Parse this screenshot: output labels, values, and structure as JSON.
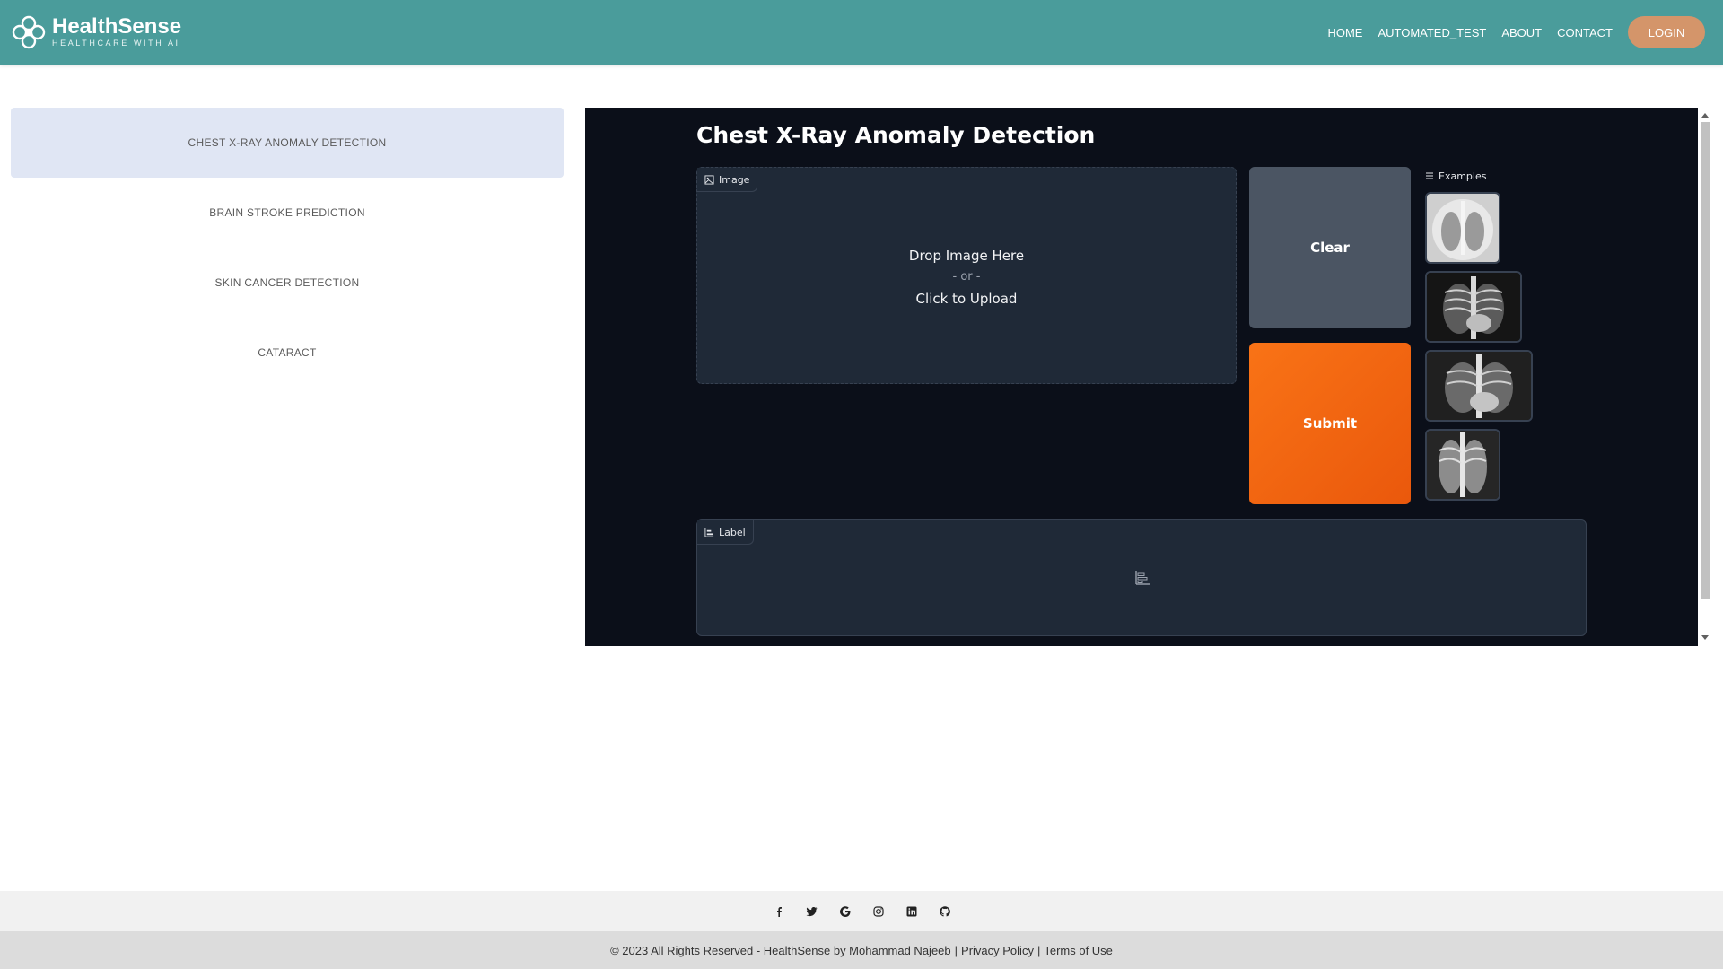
{
  "brand": {
    "name": "HealthSense",
    "tagline": "HEALTHCARE WITH AI"
  },
  "nav": {
    "items": [
      {
        "label": "HOME"
      },
      {
        "label": "AUTOMATED_TEST"
      },
      {
        "label": "ABOUT"
      },
      {
        "label": "CONTACT"
      }
    ],
    "login_label": "LOGIN"
  },
  "sidebar": {
    "items": [
      {
        "label": "CHEST X-RAY ANOMALY DETECTION",
        "active": true
      },
      {
        "label": "BRAIN STROKE PREDICTION",
        "active": false
      },
      {
        "label": "SKIN CANCER DETECTION",
        "active": false
      },
      {
        "label": "CATARACT",
        "active": false
      }
    ]
  },
  "app": {
    "title": "Chest X-Ray Anomaly Detection",
    "image_block": {
      "label": "Image",
      "drop_text": "Drop Image Here",
      "or_text": "- or -",
      "click_text": "Click to Upload"
    },
    "clear_label": "Clear",
    "submit_label": "Submit",
    "examples_label": "Examples",
    "label_block": {
      "label": "Label"
    }
  },
  "footer": {
    "social": [
      "facebook-icon",
      "twitter-icon",
      "google-icon",
      "instagram-icon",
      "linkedin-icon",
      "github-icon"
    ],
    "copyright": "© 2023 All Rights Reserved - HealthSense by Mohammad Najeeb",
    "privacy": "Privacy Policy",
    "terms": "Terms of Use"
  },
  "colors": {
    "header": "#4a9c9b",
    "login": "#d4956a",
    "sidebar_active": "#e0e6f4",
    "app_bg": "#0b0f19",
    "panel": "#1f2937",
    "submit": "#f97316"
  }
}
